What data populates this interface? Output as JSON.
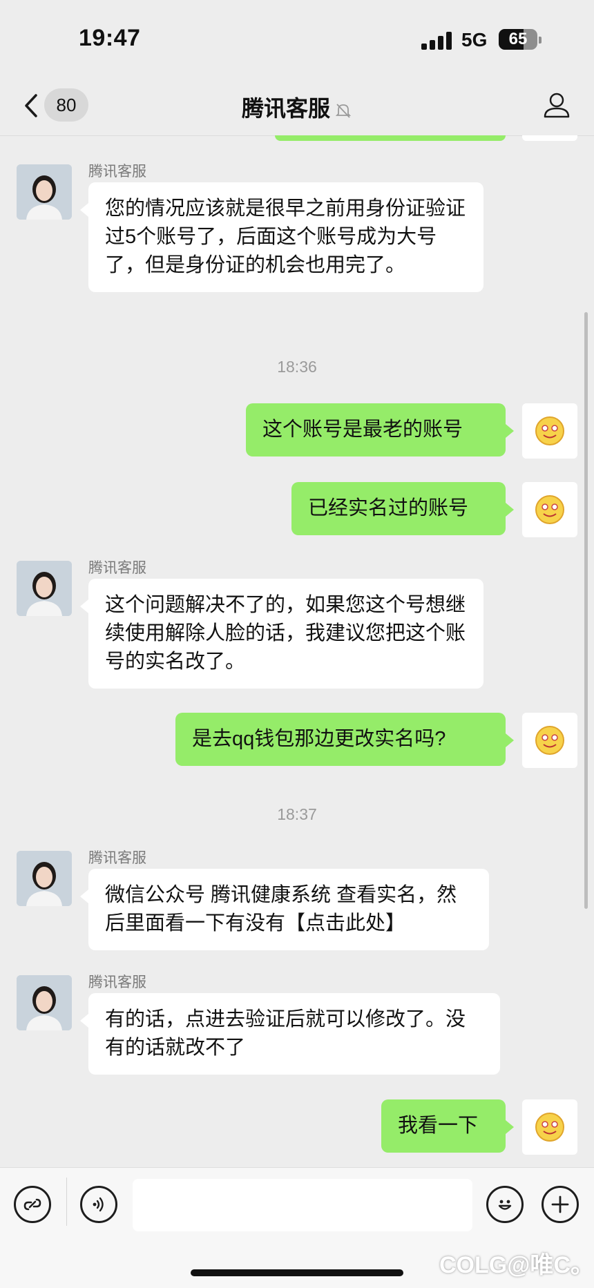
{
  "status_bar": {
    "time": "19:47",
    "network": "5G",
    "battery_level": 65,
    "battery_text": "65"
  },
  "nav": {
    "unread_count": "80",
    "title": "腾讯客服",
    "muted_icon": "bell-slash-icon",
    "profile_icon": "person-icon"
  },
  "messages": [
    {
      "side": "left",
      "sender": "腾讯客服",
      "text": "您的情况应该就是很早之前用身份证验证过5个账号了，后面这个账号成为大号了，但是身份证的机会也用完了。"
    },
    {
      "timestamp": "18:36"
    },
    {
      "side": "right",
      "text": "这个账号是最老的账号"
    },
    {
      "side": "right",
      "text": "已经实名过的账号"
    },
    {
      "side": "left",
      "sender": "腾讯客服",
      "text": "这个问题解决不了的，如果您这个号想继续使用解除人脸的话，我建议您把这个账号的实名改了。"
    },
    {
      "side": "right",
      "text": "是去qq钱包那边更改实名吗?"
    },
    {
      "timestamp": "18:37"
    },
    {
      "side": "left",
      "sender": "腾讯客服",
      "text": "微信公众号 腾讯健康系统 查看实名，然后里面看一下有没有【点击此处】"
    },
    {
      "side": "left",
      "sender": "腾讯客服",
      "text": "有的话，点进去验证后就可以修改了。没有的话就改不了"
    },
    {
      "side": "right",
      "text": "我看一下"
    }
  ],
  "input_bar": {
    "text_value": "",
    "icons": [
      "mini-program-icon",
      "voice-icon",
      "emoji-icon",
      "plus-icon"
    ]
  },
  "watermark": "COLG@唯C。",
  "colors": {
    "background": "#ededed",
    "my_bubble": "#95ec69",
    "their_bubble": "#ffffff"
  }
}
